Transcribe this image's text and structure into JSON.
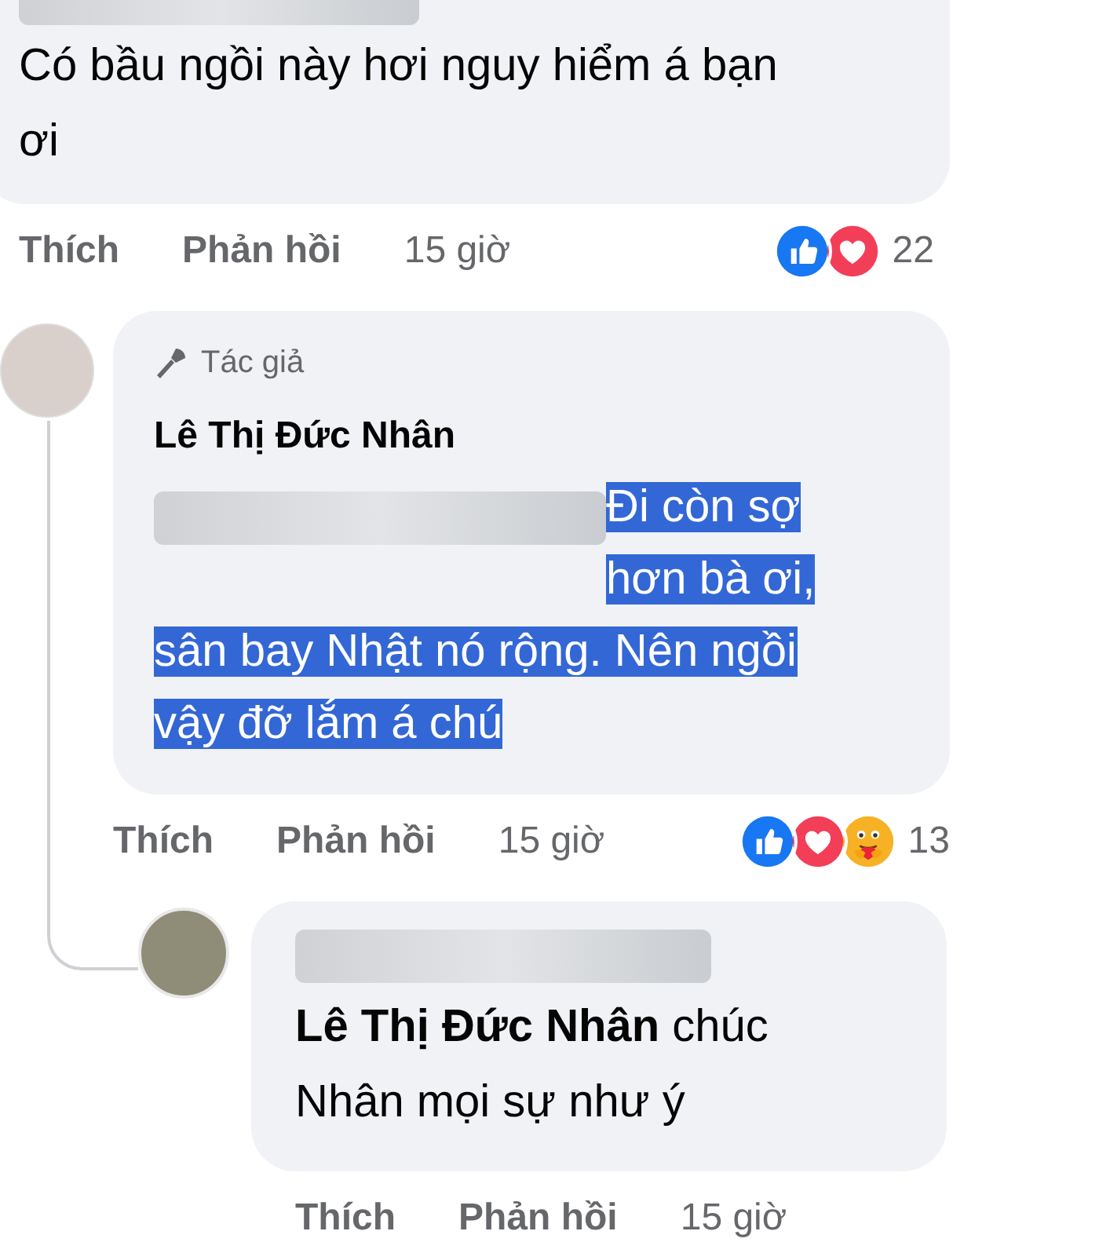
{
  "comments": [
    {
      "text": "Có bầu ngồi này hơi nguy hiểm á bạn ơi",
      "highlighted": false,
      "actions": {
        "like": "Thích",
        "reply": "Phản hồi",
        "time": "15 giờ"
      },
      "reactions": {
        "types": [
          {
            "kind": "like"
          },
          {
            "kind": "love"
          }
        ],
        "count": "22"
      }
    },
    {
      "author_badge": "Tác giả",
      "author": "Lê Thị Đức Nhân",
      "text": "Đi còn sợ hơn bà ơi, sân bay Nhật nó rộng. Nên ngồi vậy đỡ lắm á chú",
      "highlighted": true,
      "actions": {
        "like": "Thích",
        "reply": "Phản hồi",
        "time": "15 giờ"
      },
      "reactions": {
        "types": [
          {
            "kind": "like"
          },
          {
            "kind": "love"
          },
          {
            "kind": "care"
          }
        ],
        "count": "13"
      },
      "replies": [
        {
          "text": "**Lê Thị Đức Nhân** chúc Nhân mọi sự như ý",
          "actions": {
            "like": "Thích",
            "reply": "Phản hồi",
            "time": "15 giờ"
          }
        }
      ]
    }
  ]
}
